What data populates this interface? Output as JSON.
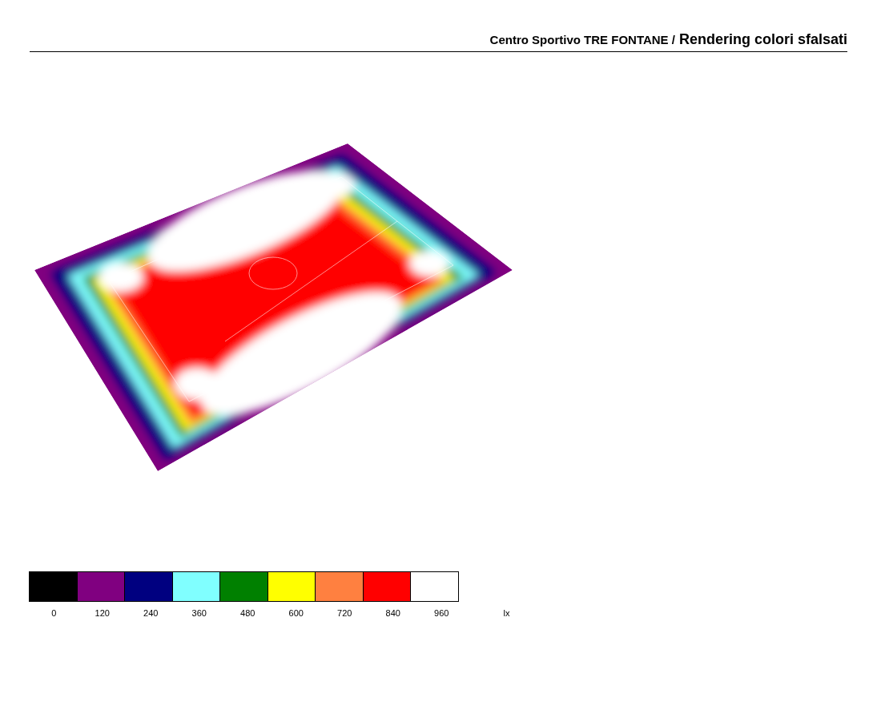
{
  "header": {
    "project": "Centro Sportivo TRE FONTANE /",
    "title": "Rendering colori sfalsati"
  },
  "legend": {
    "unit": "lx",
    "items": [
      {
        "label": "0",
        "color": "#000000"
      },
      {
        "label": "120",
        "color": "#800080"
      },
      {
        "label": "240",
        "color": "#000080"
      },
      {
        "label": "360",
        "color": "#80ffff"
      },
      {
        "label": "480",
        "color": "#008000"
      },
      {
        "label": "600",
        "color": "#ffff00"
      },
      {
        "label": "720",
        "color": "#ff8040"
      },
      {
        "label": "840",
        "color": "#ff0000"
      },
      {
        "label": "960",
        "color": "#ffffff"
      }
    ]
  }
}
